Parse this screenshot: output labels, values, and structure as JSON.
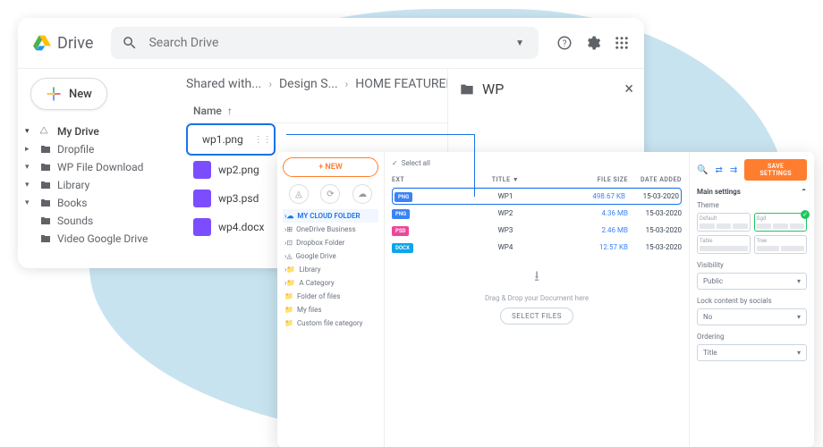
{
  "drive": {
    "title": "Drive",
    "search_placeholder": "Search Drive",
    "new_button": "New",
    "my_drive": "My Drive",
    "tree": {
      "dropfile": "Dropfile",
      "wpfd": "WP File Download",
      "library": "Library",
      "books": "Books",
      "sounds": "Sounds",
      "vgd": "Video Google Drive"
    },
    "breadcrumb": {
      "b1": "Shared with...",
      "b2": "Design S...",
      "b3": "HOME FEATURED ...",
      "b4": "..."
    },
    "name_col": "Name",
    "files": {
      "f1": "wp1.png",
      "f2": "wp2.png",
      "f3": "wp3.psd",
      "f4": "wp4.docx"
    },
    "wp_panel_title": "WP"
  },
  "overlay": {
    "new_btn": "+ NEW",
    "tree": {
      "cloud": "MY CLOUD FOLDER",
      "onedrive": "OneDrive Business",
      "dropbox": "Dropbox Folder",
      "gdrive": "Google Drive",
      "library": "Library",
      "acat": "A Category",
      "fof": "Folder of files",
      "myfiles": "My files",
      "custom": "Custom file category"
    },
    "selectall": "Select all",
    "headers": {
      "ext": "EXT",
      "title": "TITLE",
      "size": "FILE SIZE",
      "date": "DATE ADDED"
    },
    "rows": [
      {
        "ext": "PNG",
        "ext_cls": "ext-png",
        "title": "WP1",
        "size": "498.67 KB",
        "date": "15-03-2020"
      },
      {
        "ext": "PNG",
        "ext_cls": "ext-png",
        "title": "WP2",
        "size": "4.36 MB",
        "date": "15-03-2020"
      },
      {
        "ext": "PSD",
        "ext_cls": "ext-psd",
        "title": "WP3",
        "size": "2.46 MB",
        "date": "15-03-2020"
      },
      {
        "ext": "DOCX",
        "ext_cls": "ext-docx",
        "title": "WP4",
        "size": "12.57 KB",
        "date": "15-03-2020"
      }
    ],
    "dropzone": {
      "text": "Drag & Drop your Document here",
      "btn": "SELECT FILES"
    },
    "right": {
      "save": "SAVE SETTINGS",
      "main_settings": "Main settings",
      "theme": "Theme",
      "themes": {
        "default": "Default",
        "ggd": "Ggd",
        "table": "Table",
        "tree": "Tree"
      },
      "visibility": "Visibility",
      "visibility_val": "Public",
      "lock": "Lock content by socials",
      "lock_val": "No",
      "ordering": "Ordering",
      "ordering_val": "Title"
    }
  }
}
